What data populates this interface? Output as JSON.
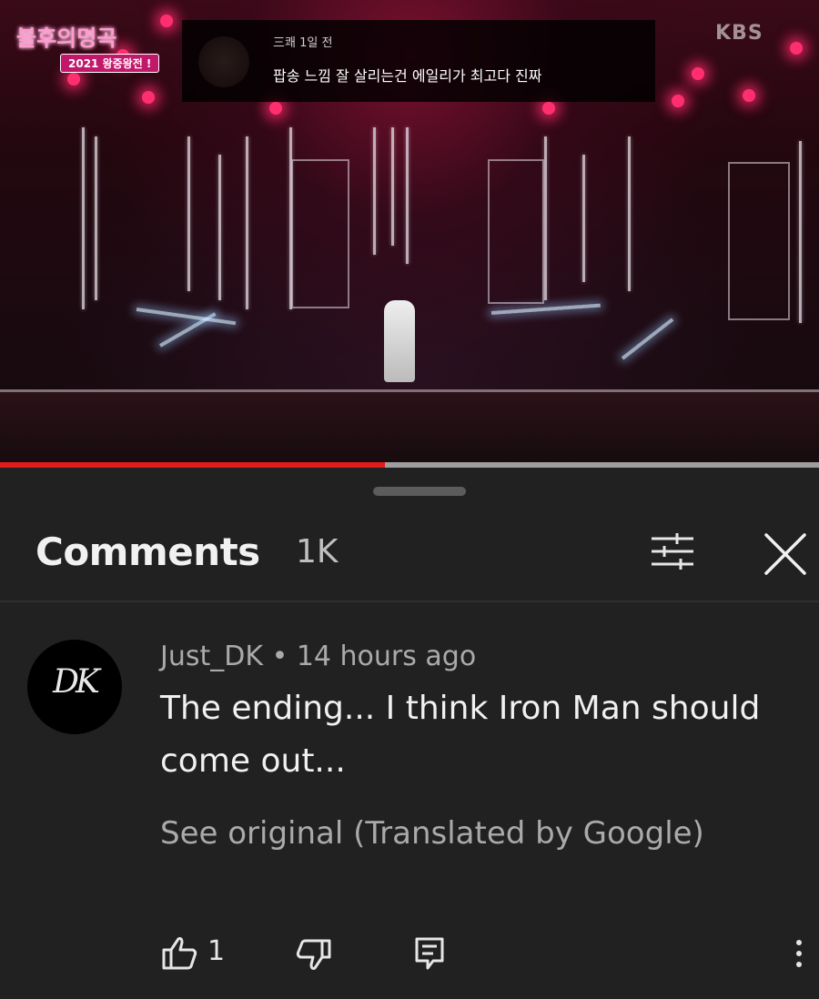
{
  "video": {
    "logo_title": "불후의명곡",
    "logo_subtitle": "2021 왕중왕전 !",
    "overlay_comment": {
      "meta": "三쾌 1일 전",
      "text": "팝송 느낌 잘 살리는건 에일리가 최고다 진짜"
    },
    "broadcaster": "KBS",
    "progress_fraction": 0.47
  },
  "comments_panel": {
    "title": "Comments",
    "count": "1K",
    "filter_icon": "sliders-icon",
    "close_icon": "close-icon"
  },
  "comment": {
    "author": "Just_DK",
    "separator": "•",
    "time": "14 hours ago",
    "avatar_text": "DK",
    "text": "The ending... I think Iron Man should come out...",
    "translate_label": "See original (Translated by Google)",
    "like_count": "1",
    "icons": {
      "like": "thumbs-up-icon",
      "dislike": "thumbs-down-icon",
      "reply": "reply-icon",
      "more": "more-vertical-icon"
    }
  },
  "colors": {
    "panel_bg": "#212121",
    "progress_red": "#e21b1b",
    "secondary_text": "#aaaaaa"
  }
}
